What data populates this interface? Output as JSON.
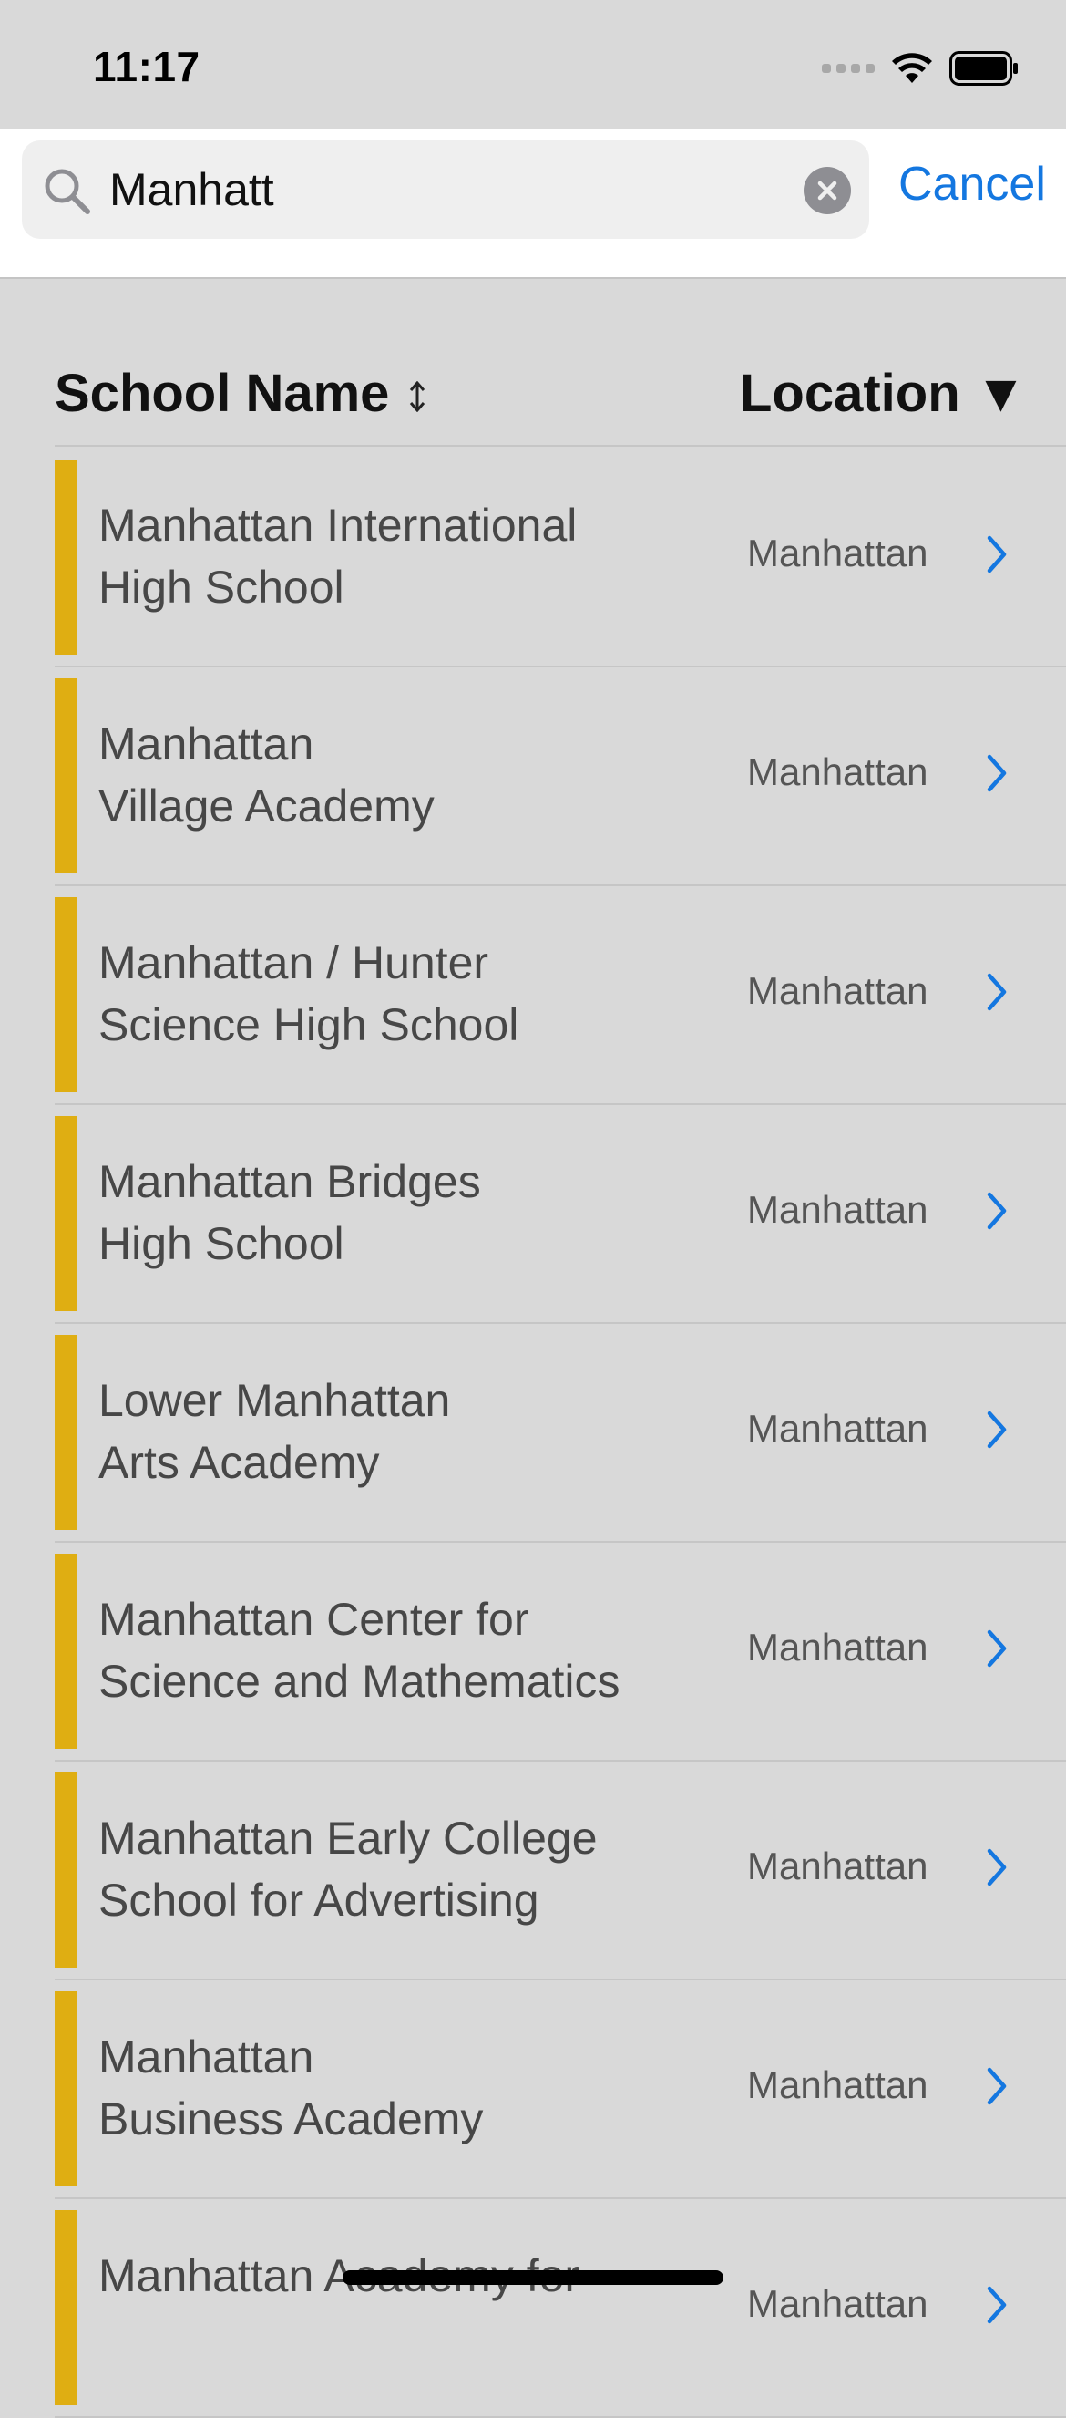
{
  "status_bar": {
    "time": "11:17"
  },
  "search": {
    "query": "Manhatt",
    "cancel_label": "Cancel"
  },
  "table_header": {
    "school_name": "School Name",
    "location": "Location ▼"
  },
  "rows": [
    {
      "name": "Manhattan International\nHigh School",
      "location": "Manhattan"
    },
    {
      "name": "Manhattan\nVillage Academy",
      "location": "Manhattan"
    },
    {
      "name": "Manhattan / Hunter\nScience High School",
      "location": "Manhattan"
    },
    {
      "name": "Manhattan Bridges\nHigh School",
      "location": "Manhattan"
    },
    {
      "name": "Lower Manhattan\nArts Academy",
      "location": "Manhattan"
    },
    {
      "name": "Manhattan Center for\nScience and Mathematics",
      "location": "Manhattan"
    },
    {
      "name": "Manhattan Early College\nSchool for Advertising",
      "location": "Manhattan"
    },
    {
      "name": "Manhattan\nBusiness Academy",
      "location": "Manhattan"
    },
    {
      "name": "Manhattan Academy for",
      "location": "Manhattan"
    }
  ],
  "colors": {
    "accent": "#1477e0",
    "row_marker": "#dfae12",
    "background": "#d9d9d9"
  }
}
